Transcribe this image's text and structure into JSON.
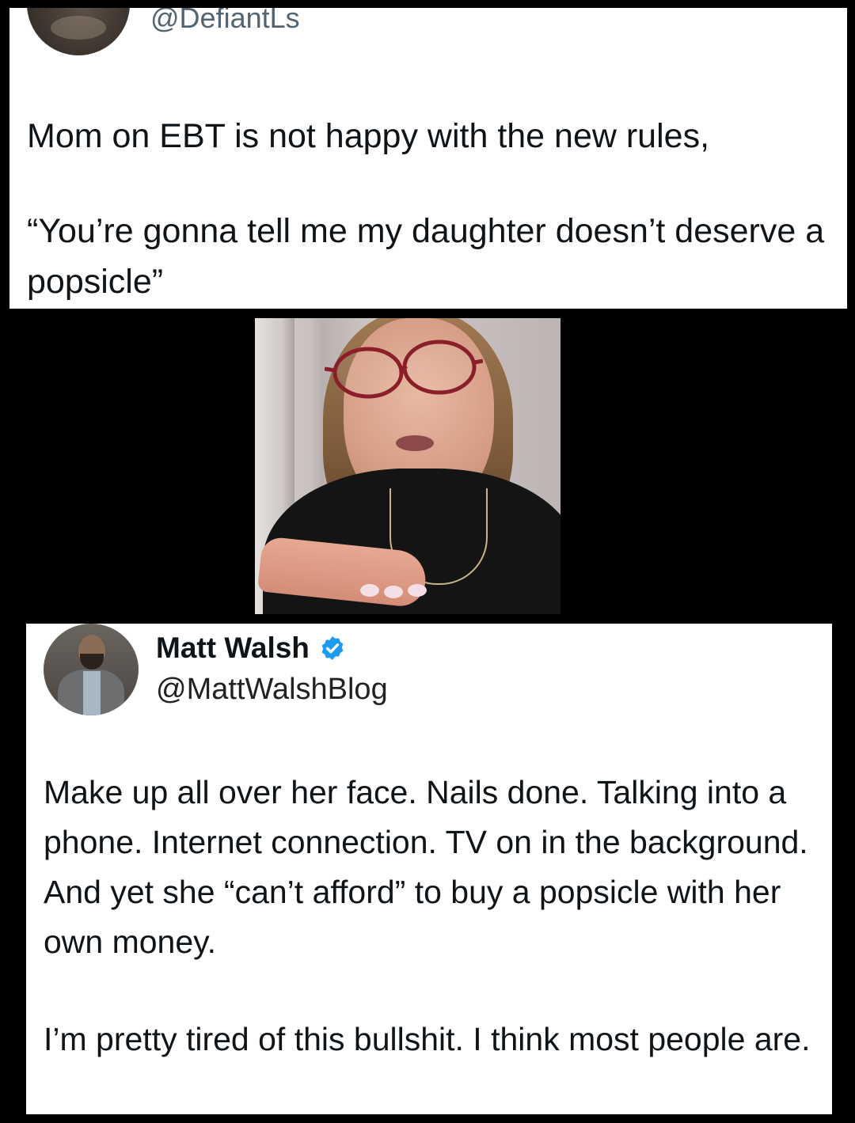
{
  "tweet1": {
    "handle": "@DefiantLs",
    "text_line1": "Mom on EBT is not happy with the new rules,",
    "text_quote": "“You’re gonna tell me my daughter doesn’t deserve a popsicle”"
  },
  "photo": {
    "icon": "video-still-photo"
  },
  "tweet2": {
    "name": "Matt Walsh",
    "verified_icon": "verified-badge-icon",
    "handle": "@MattWalshBlog",
    "paragraph1": "Make up all over her face. Nails done. Talking into a phone. Internet connection. TV on in the background. And yet she “can’t afford” to buy a popsicle with her own money.",
    "paragraph2": "I’m pretty tired of this bullshit. I think most people are."
  },
  "colors": {
    "background": "#000000",
    "card": "#ffffff",
    "handle_gray": "#536471",
    "verified_blue": "#1d9bf0"
  }
}
